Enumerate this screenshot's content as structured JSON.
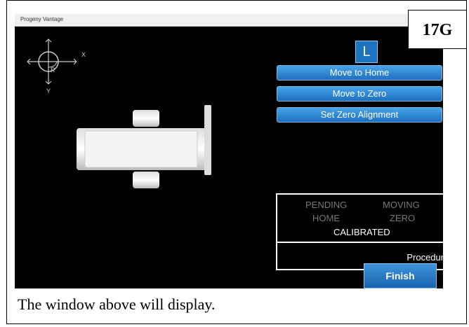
{
  "window": {
    "title": "Progeny Vantage"
  },
  "figure_tag": "17G",
  "side_button": "L",
  "axes": {
    "x_label": "X",
    "y_label": "Y",
    "r_label": "R"
  },
  "buttons": {
    "move_home": "Move to Home",
    "move_zero": "Move to Zero",
    "set_zero": "Set Zero Alignment",
    "finish": "Finish"
  },
  "status": {
    "pending": "PENDING",
    "moving": "MOVING",
    "home": "HOME",
    "zero": "ZERO",
    "calibrated": "CALIBRATED",
    "procedure": "Procedun"
  },
  "caption": "The window above will display."
}
